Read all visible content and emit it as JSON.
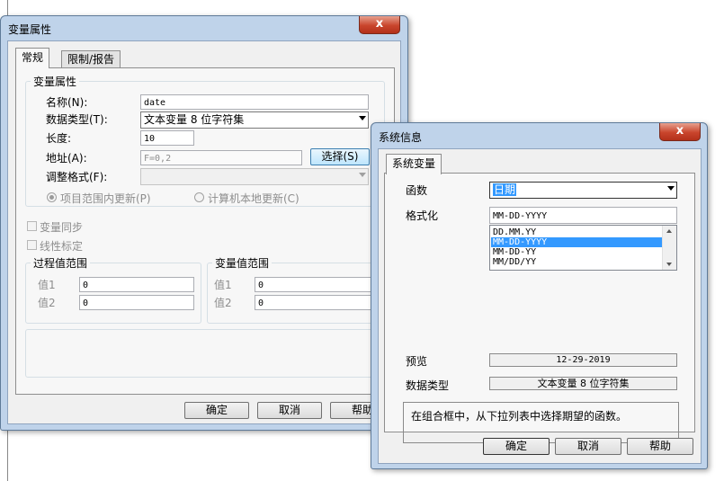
{
  "var_props": {
    "title": "变量属性",
    "close_glyph": "x",
    "tabs": [
      {
        "label": "常规"
      },
      {
        "label": "限制/报告"
      }
    ],
    "group_var_props": "变量属性",
    "name_label": "名称(N):",
    "name_value": "date",
    "datatype_label": "数据类型(T):",
    "datatype_value": "文本变量 8 位字符集",
    "length_label": "长度:",
    "length_value": "10",
    "address_label": "地址(A):",
    "address_value": "F=0,2",
    "select_button": "选择(S)",
    "format_label": "调整格式(F):",
    "format_value": "",
    "radio_project": "项目范围内更新(P)",
    "radio_local": "计算机本地更新(C)",
    "sync_label": "变量同步",
    "linear_label": "线性标定",
    "process_range": {
      "title": "过程值范围",
      "v1_label": "值1",
      "v1_value": "0",
      "v2_label": "值2",
      "v2_value": "0"
    },
    "var_range": {
      "title": "变量值范围",
      "v1_label": "值1",
      "v1_value": "0",
      "v2_label": "值2",
      "v2_value": "0"
    },
    "ok": "确定",
    "cancel": "取消",
    "help": "帮助"
  },
  "sys_info": {
    "title": "系统信息",
    "close_glyph": "x",
    "tab": "系统变量",
    "function_label": "函数",
    "function_value": "日期",
    "format_label": "格式化",
    "format_value": "MM-DD-YYYY",
    "format_options": [
      "DD.MM.YY",
      "MM-DD-YYYY",
      "MM-DD-YY",
      "MM/DD/YY"
    ],
    "selected_option": "MM-DD-YYYY",
    "preview_label": "预览",
    "preview_value": "12-29-2019",
    "datatype_label": "数据类型",
    "datatype_value": "文本变量 8 位字符集",
    "hint": "在组合框中，从下拉列表中选择期望的函数。",
    "ok": "确定",
    "cancel": "取消",
    "help": "帮助"
  },
  "colors": {
    "selection": "#3399ff",
    "window_frame": "#bfd3ea",
    "close_button": "#c9452c"
  }
}
